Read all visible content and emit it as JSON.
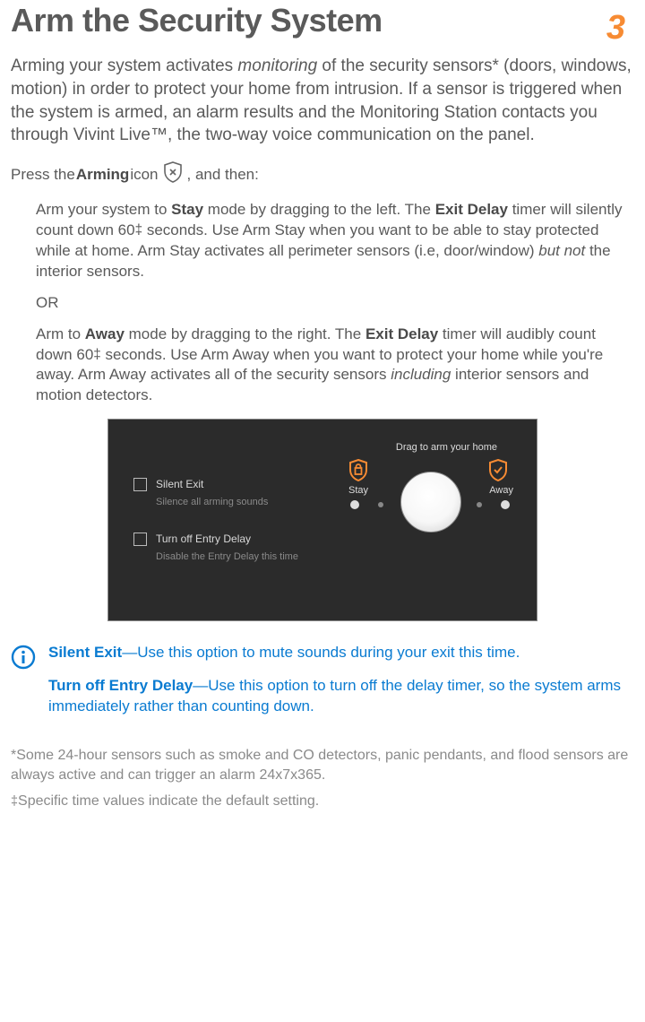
{
  "page_number": "3",
  "title": "Arm the Security System",
  "intro": {
    "t1": "Arming your system activates ",
    "t2": "monitoring",
    "t3": " of the security sensors* (doors, windows, motion) in order to protect your home from intrusion. If a sensor is triggered when the system is armed, an alarm results and the Monitoring Station contacts you through Vivint Live™, the two-way voice communication on the panel."
  },
  "press": {
    "t1": "Press the ",
    "t2": "Arming",
    "t3": " icon ",
    "t4": ", and then:"
  },
  "step_stay": {
    "t1": "Arm your system to ",
    "t2": "Stay",
    "t3": " mode by dragging to the left. The ",
    "t4": "Exit Delay",
    "t5": " timer will silently count down 60",
    "t6": " seconds. Use Arm Stay when you want to be able to stay protected while at home. Arm Stay activates all perimeter sensors (i.e, door/window) ",
    "t7": "but not",
    "t8": " the interior sensors."
  },
  "or": "OR",
  "step_away": {
    "t1": "Arm to ",
    "t2": "Away",
    "t3": " mode by dragging to the right. The ",
    "t4": "Exit Delay",
    "t5": " timer will audibly count down 60",
    "t6": " seconds. Use Arm Away when you want to protect your home while you're away. Arm Away activates all of the security sensors ",
    "t7": "including",
    "t8": " interior sensors and motion detectors."
  },
  "panel": {
    "drag_hint": "Drag to arm your home",
    "stay": "Stay",
    "away": "Away",
    "silent_title": "Silent Exit",
    "silent_sub": "Silence all arming sounds",
    "entry_title": "Turn off Entry Delay",
    "entry_sub": "Disable the Entry Delay this time"
  },
  "info": {
    "se_label": "Silent Exit",
    "se_dash": "—",
    "se_text": "Use this option to mute sounds during your exit this time.",
    "ed_label": "Turn off Entry Delay",
    "ed_dash": "—",
    "ed_text": "Use this option to turn off the delay timer, so the system arms immediately rather than counting down."
  },
  "footnotes": {
    "star": "*Some 24-hour sensors such as smoke and CO detectors, panic pendants, and flood sensors are always active and can trigger an alarm 24x7x365.",
    "dagger_mark": "‡",
    "dagger_text": "Specific time values indicate the default setting."
  }
}
